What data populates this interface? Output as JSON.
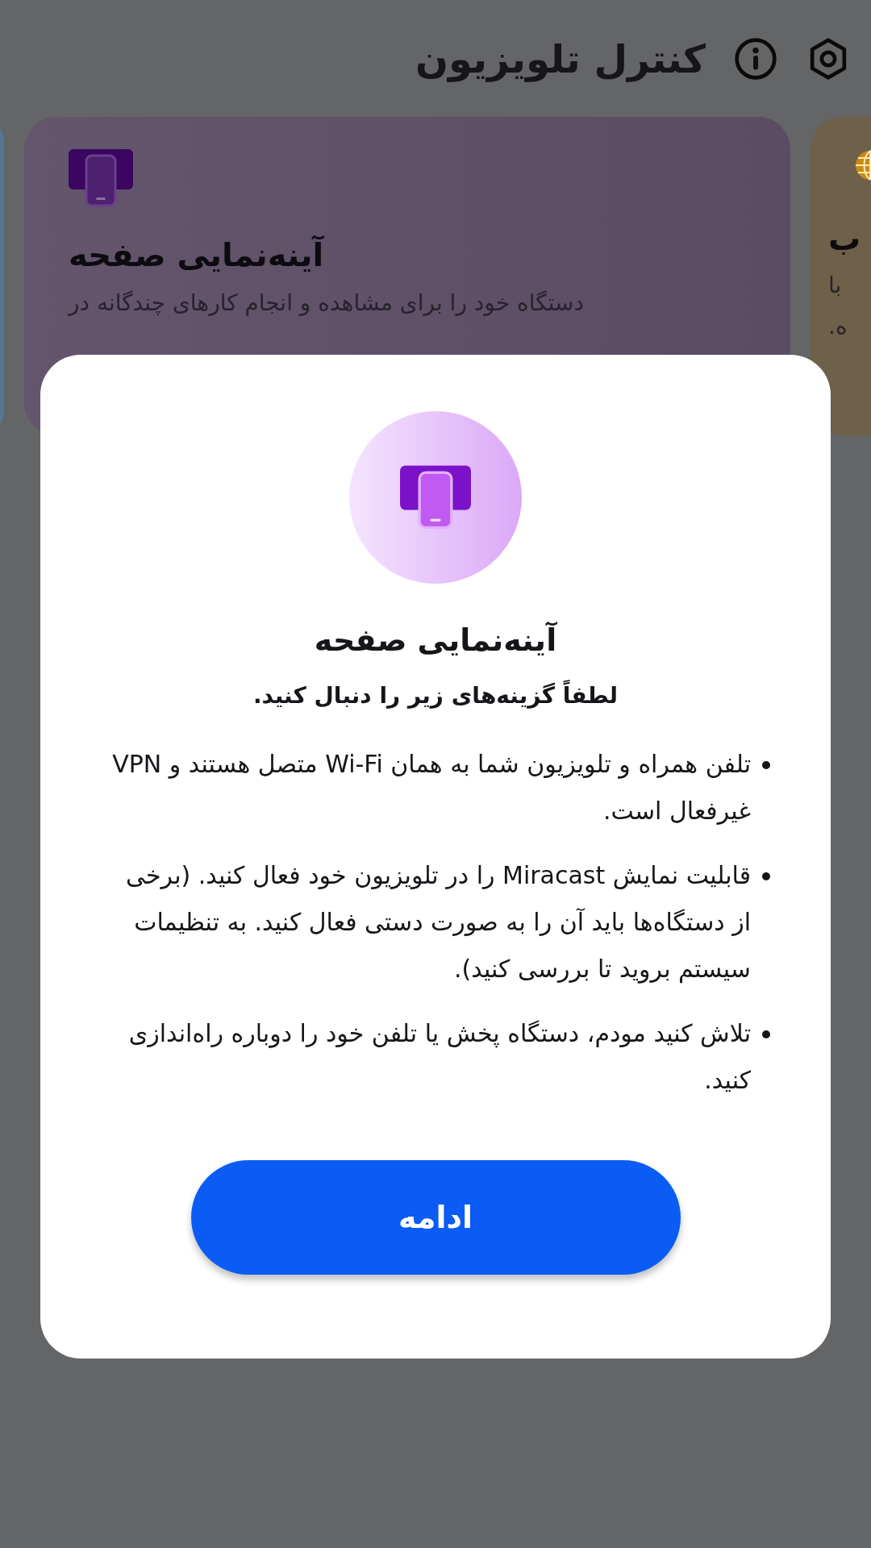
{
  "header": {
    "title": "کنترل تلویزیون"
  },
  "cards": [
    {
      "kind": "edge",
      "color": "#6e6049",
      "title": "ب",
      "lines": [
        "با",
        "ه."
      ]
    },
    {
      "kind": "full",
      "color": "#5f5068",
      "title": "آینه‌نمایی صفحه",
      "description": "دستگاه خود را برای مشاهده و انجام کارهای چندگانه در"
    },
    {
      "kind": "sliver",
      "color": "#587495"
    }
  ],
  "dialog": {
    "title": "آینه‌نمایی صفحه",
    "subtitle": "لطفاً گزینه‌های زیر را دنبال کنید.",
    "bullets": [
      "تلفن همراه و تلویزیون شما به همان Wi-Fi متصل هستند و VPN غیرفعال است.",
      "قابلیت نمایش Miracast را در تلویزیون خود فعال کنید. (برخی از دستگاه‌ها باید آن را به صورت دستی فعال کنید. به تنظیمات سیستم بروید تا بررسی کنید).",
      "تلاش کنید مودم، دستگاه پخش یا تلفن خود را دوباره راه‌اندازی کنید."
    ],
    "button": "ادامه"
  }
}
